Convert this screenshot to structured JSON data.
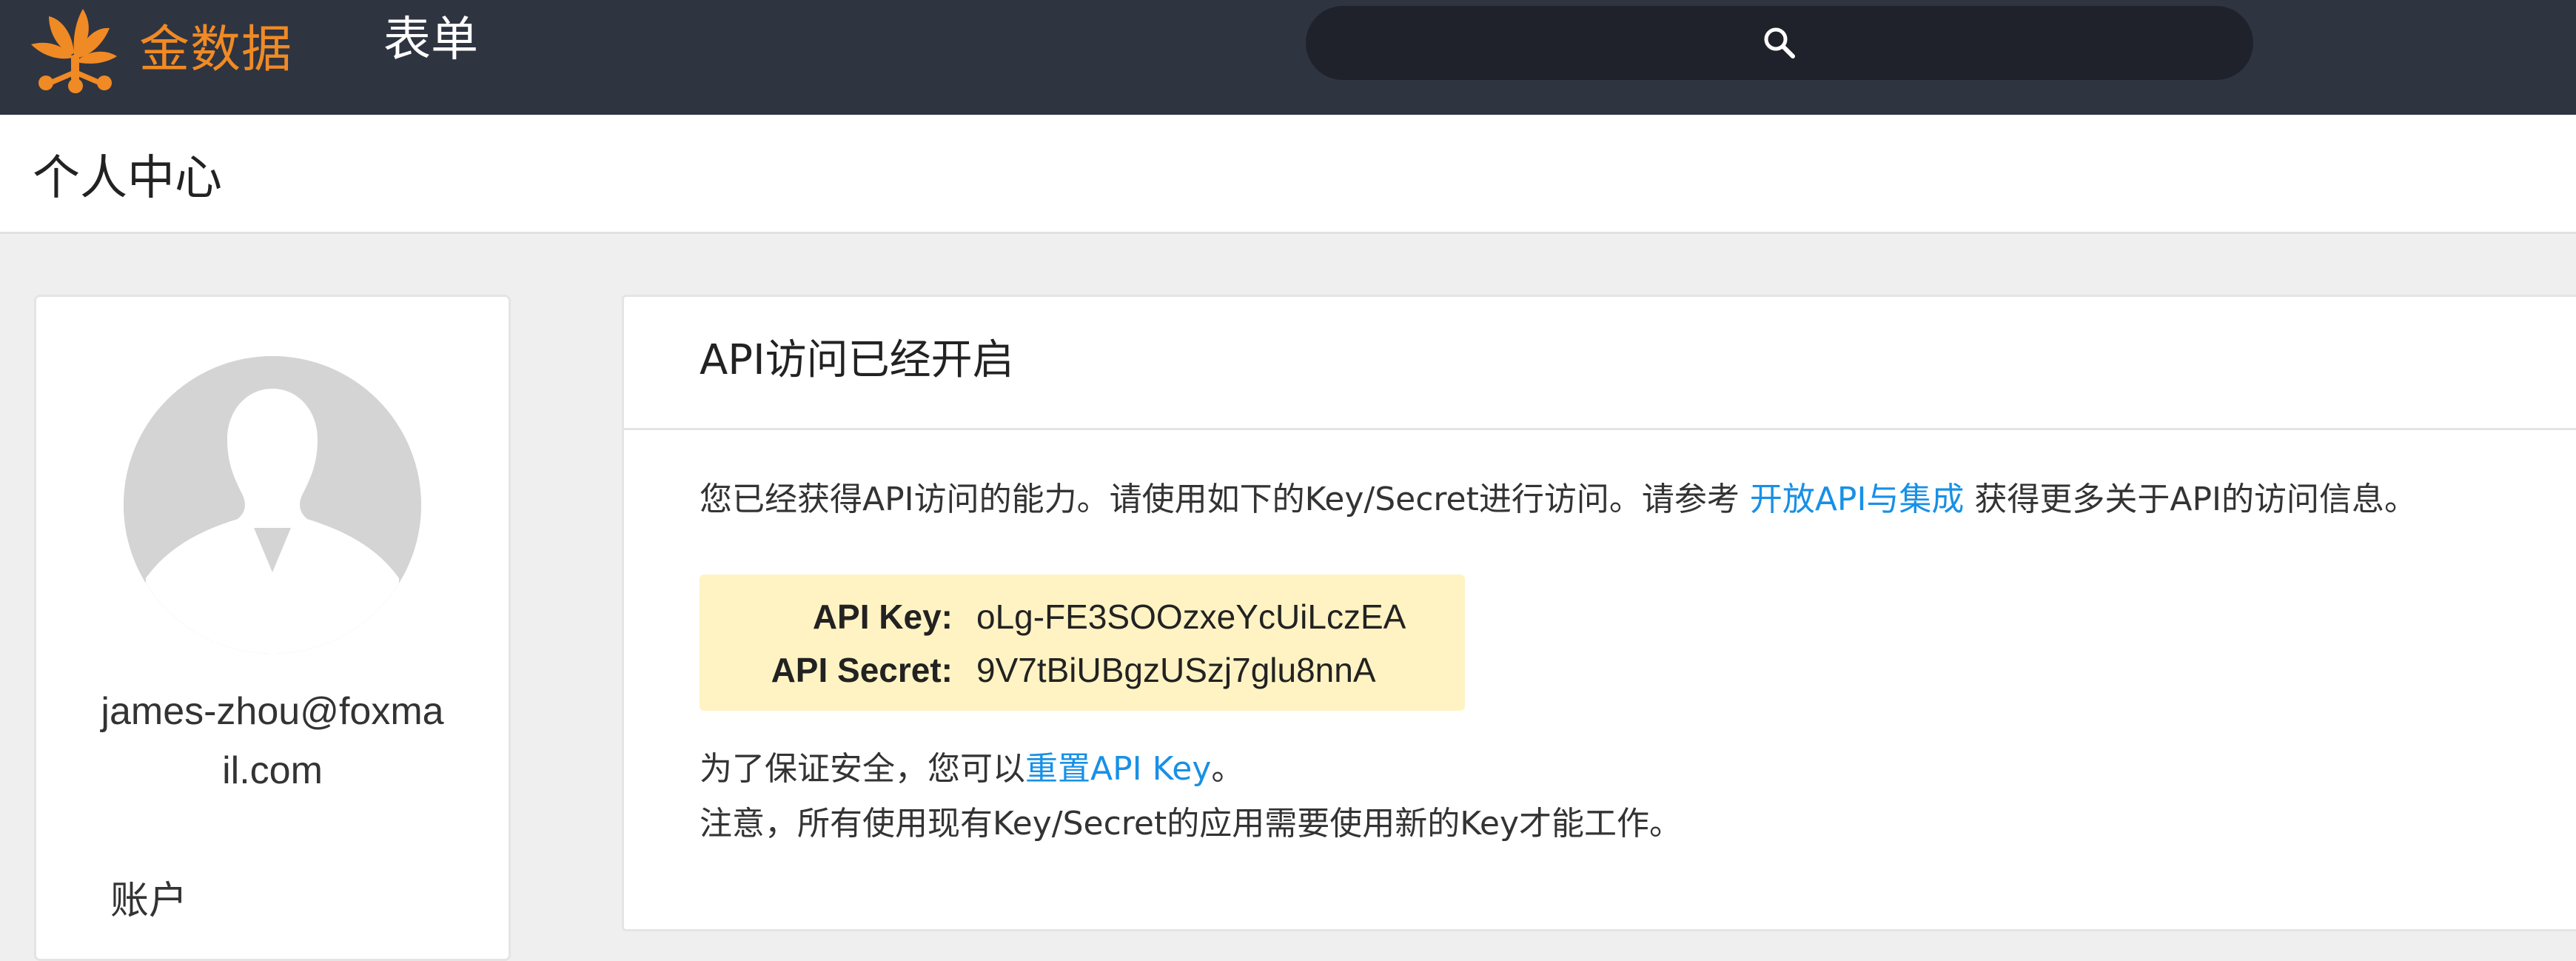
{
  "topbar": {
    "logo_text": "金数据",
    "nav_form": "表单",
    "search_icon": "search-icon",
    "logo_color": "#f08a24",
    "bg_color": "#2f3441"
  },
  "page": {
    "title": "个人中心"
  },
  "profile": {
    "email": "james-zhou@foxmail.com",
    "account_label": "账户"
  },
  "api": {
    "title": "API访问已经开启",
    "desc_prefix": "您已经获得API访问的能力。请使用如下的Key/Secret进行访问。请参考 ",
    "desc_link": "开放API与集成",
    "desc_suffix": " 获得更多关于API的访问信息。",
    "key_label": "API Key:",
    "key_value": "oLg-FE3SOOzxeYcUiLczEA",
    "secret_label": "API Secret:",
    "secret_value": "9V7tBiUBgzUSzj7glu8nnA",
    "reset_prefix": "为了保证安全，您可以",
    "reset_link": "重置API Key",
    "reset_suffix": "。",
    "note": "注意，所有使用现有Key/Secret的应用需要使用新的Key才能工作。",
    "link_color": "#1890e6",
    "keybox_color": "#fff3c3"
  }
}
